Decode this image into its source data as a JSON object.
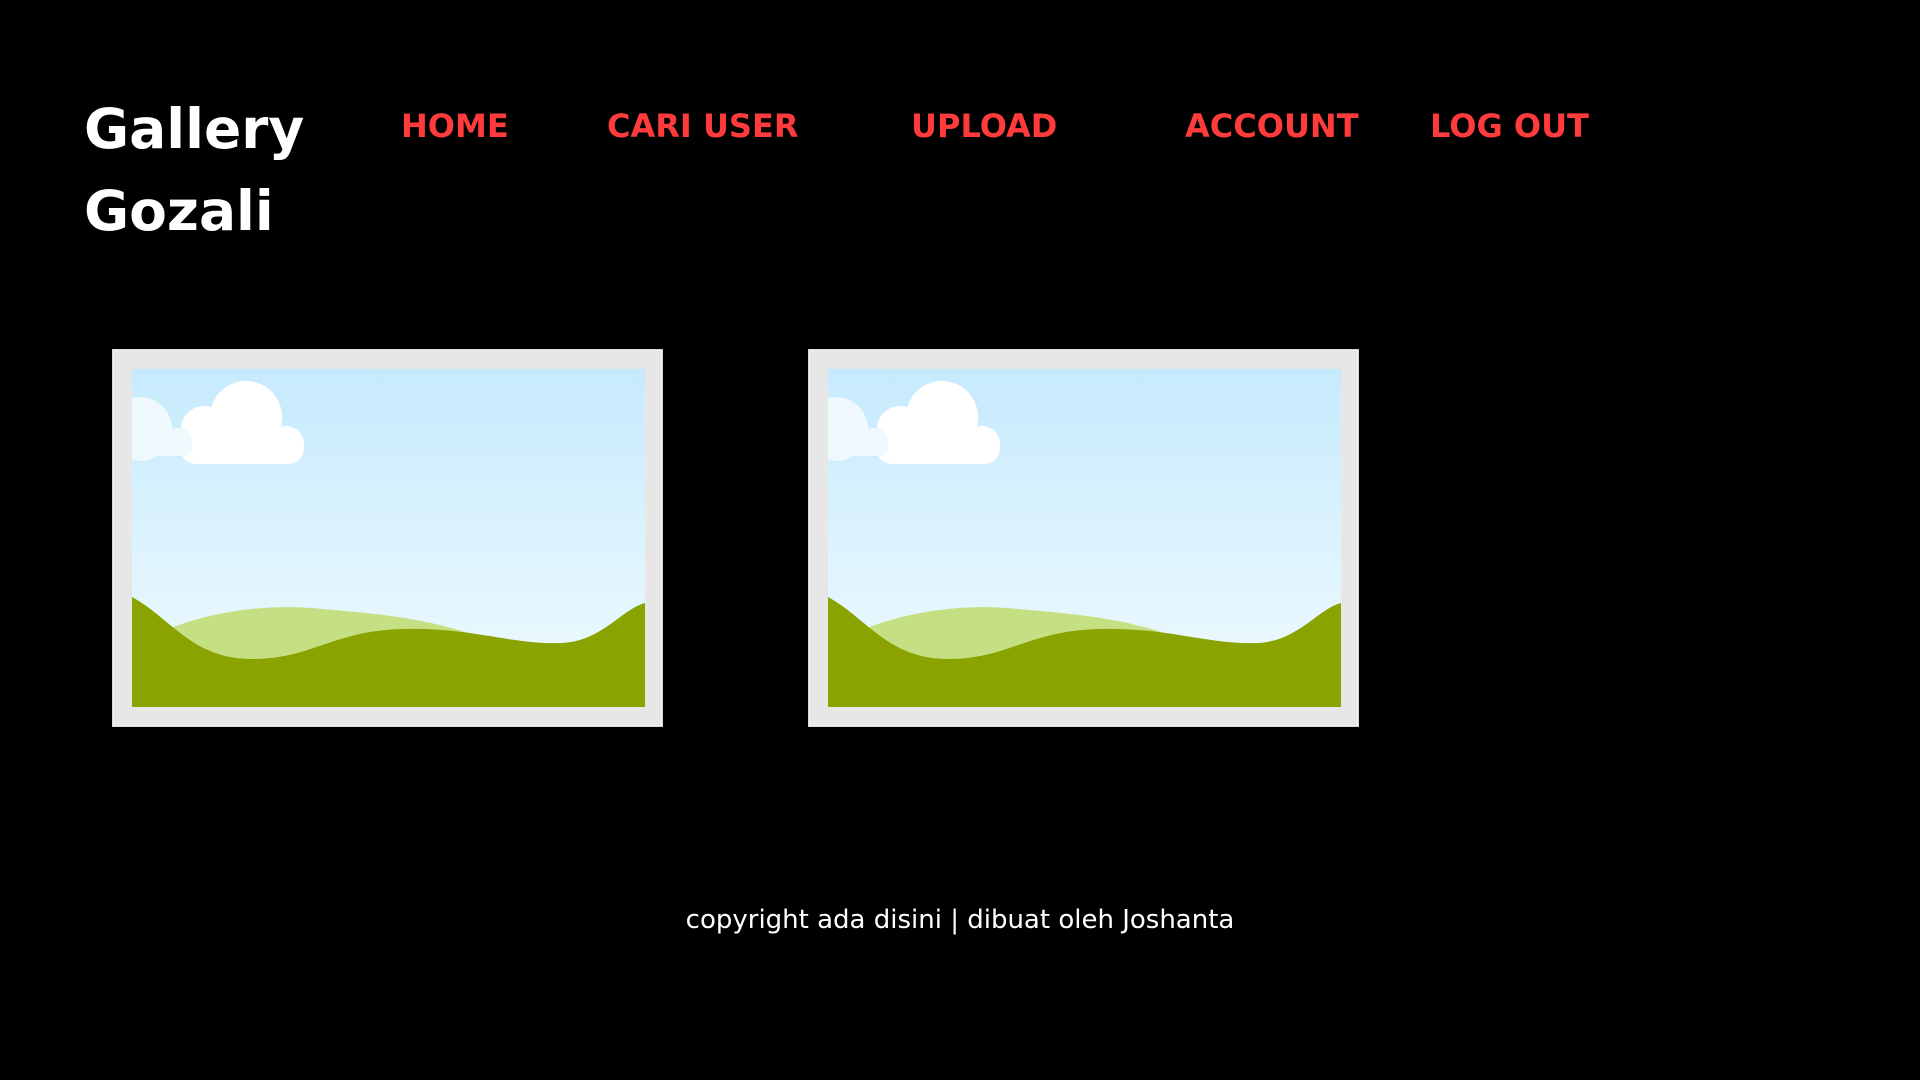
{
  "header": {
    "brand_line1": "Gallery",
    "brand_line2": "Gozali"
  },
  "nav": {
    "items": [
      {
        "label": "HOME"
      },
      {
        "label": "CARI USER"
      },
      {
        "label": "UPLOAD"
      },
      {
        "label": "ACCOUNT"
      },
      {
        "label": "LOG OUT"
      }
    ]
  },
  "gallery": {
    "items": [
      {
        "icon": "landscape-image-placeholder-icon"
      },
      {
        "icon": "landscape-image-placeholder-icon"
      }
    ]
  },
  "footer": {
    "text": "copyright ada disini | dibuat oleh Joshanta"
  },
  "colors": {
    "background": "#000000",
    "brand_text": "#ffffff",
    "nav_link": "#ff3b3b",
    "frame": "#e7e7e7",
    "sky_top": "#c6eafd",
    "sky_bottom": "#f1fbff",
    "hill_light": "#c5df83",
    "hill_dark": "#8aa300"
  }
}
